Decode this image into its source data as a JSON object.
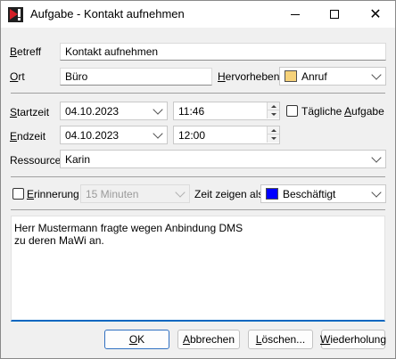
{
  "window": {
    "title": "Aufgabe - Kontakt aufnehmen",
    "icons": {
      "app": "app-logo-icon",
      "minimize": "minimize-icon",
      "maximize": "maximize-icon",
      "close": "close-icon"
    },
    "close_glyph": "✕"
  },
  "labels": {
    "betreff": "Betreff",
    "ort": "Ort",
    "hervorheben": "Hervorheben",
    "startzeit": "Startzeit",
    "endzeit": "Endzeit",
    "taegliche": "Tägliche Aufgabe",
    "ressource": "Ressource",
    "erinnerung": "Erinnerung",
    "zeit_zeigen": "Zeit zeigen als"
  },
  "fields": {
    "betreff": "Kontakt aufnehmen",
    "ort": "Büro",
    "hervorheben": {
      "value": "Anruf",
      "color": "#f6d27a"
    },
    "start_date": "04.10.2023",
    "start_time": "11:46",
    "end_date": "04.10.2023",
    "end_time": "12:00",
    "taegliche_checked": false,
    "ressource": "Karin",
    "erinnerung_checked": false,
    "erinnerung_value": "15 Minuten",
    "zeit_zeigen": {
      "value": "Beschäftigt",
      "color": "#0000ff"
    }
  },
  "memo": {
    "lines": [
      "Herr Mustermann fragte wegen Anbindung DMS",
      "zu deren MaWi an."
    ]
  },
  "buttons": {
    "ok": "OK",
    "abbrechen": "Abbrechen",
    "loeschen": "Löschen...",
    "wiederholung": "Wiederholung"
  }
}
